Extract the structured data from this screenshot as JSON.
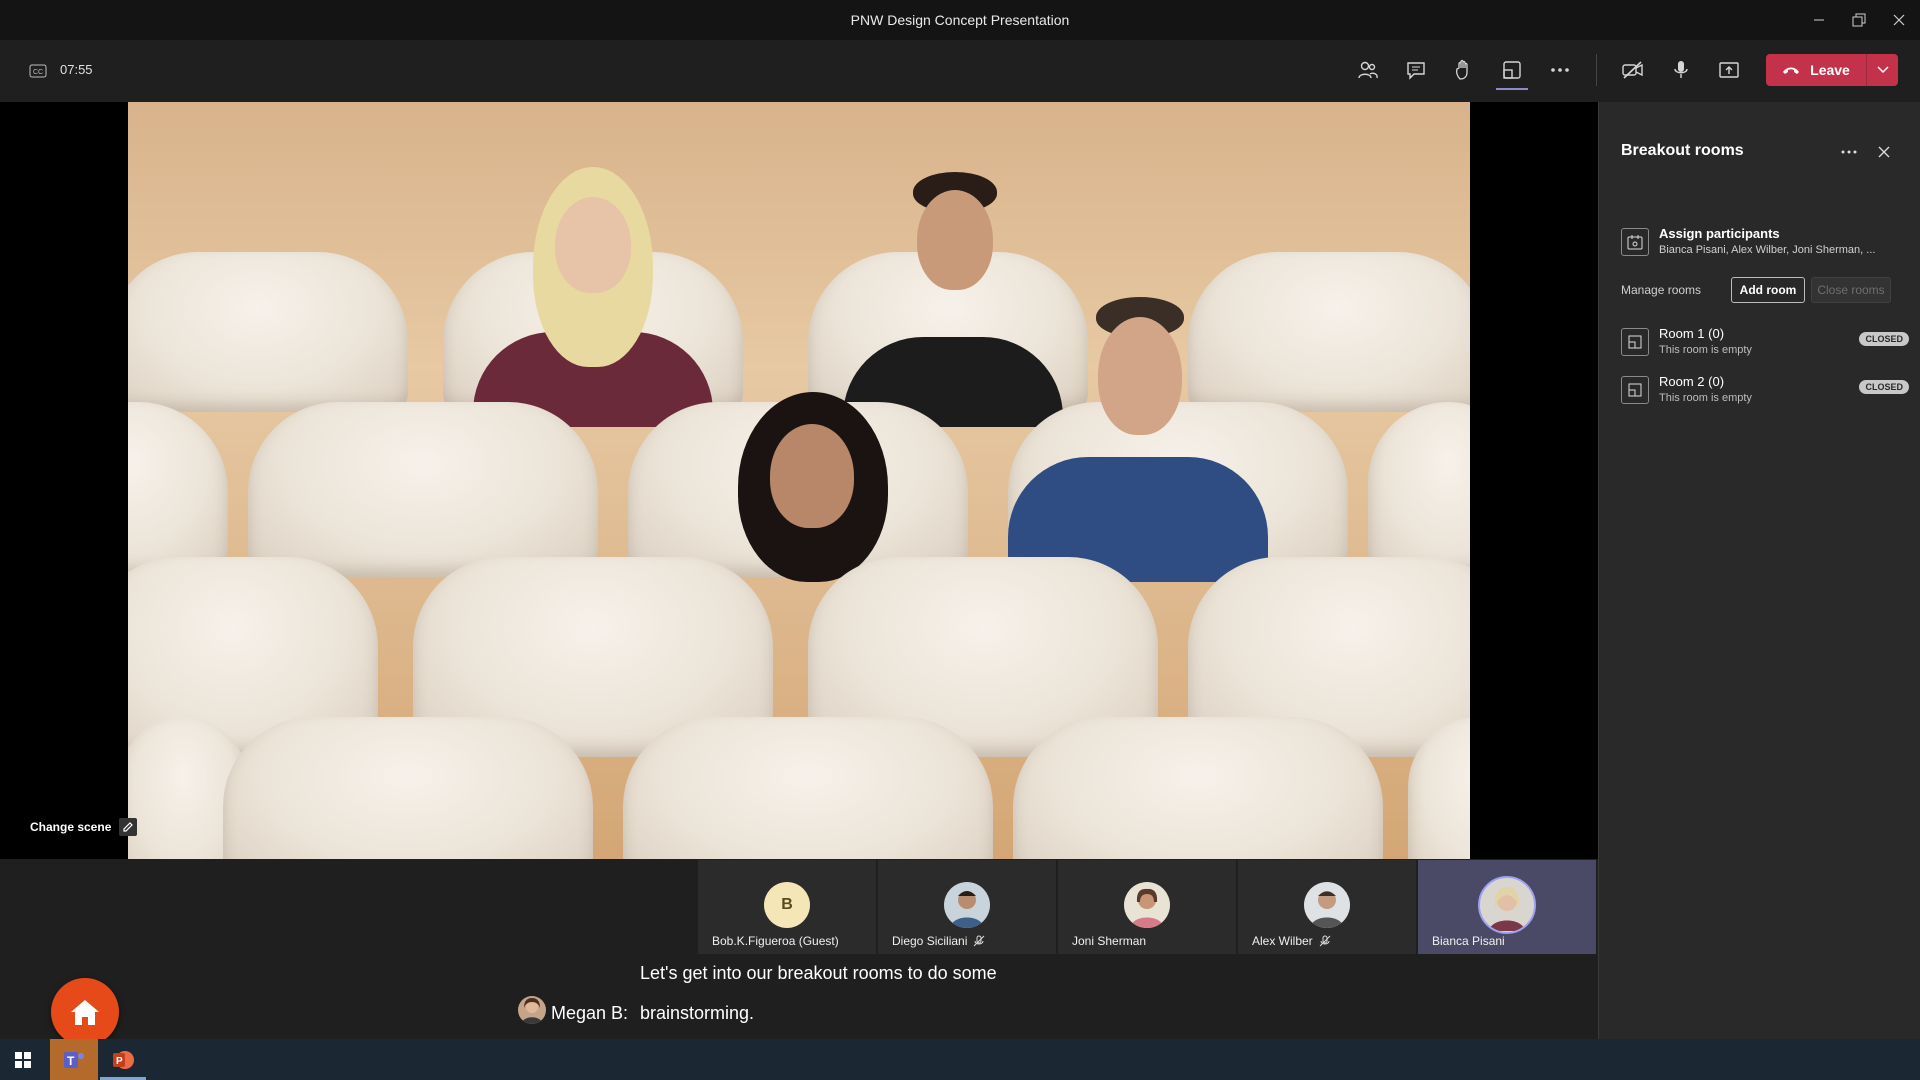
{
  "window": {
    "title": "PNW Design Concept Presentation"
  },
  "toolbar": {
    "timer": "07:55",
    "leave_label": "Leave",
    "icons": [
      "captions-icon",
      "participants-icon",
      "chat-icon",
      "raise-hand-icon",
      "breakout-rooms-icon",
      "more-icon",
      "camera-off-icon",
      "microphone-icon",
      "share-icon"
    ]
  },
  "stage": {
    "change_scene_label": "Change scene"
  },
  "participants": [
    {
      "name": "Bob.K.Figueroa (Guest)",
      "initial": "B",
      "muted": false
    },
    {
      "name": "Diego Siciliani",
      "muted": true
    },
    {
      "name": "Joni Sherman",
      "muted": false
    },
    {
      "name": "Alex Wilber",
      "muted": true
    },
    {
      "name": "Bianca Pisani",
      "muted": false
    }
  ],
  "captions": {
    "speaker": "Megan B:",
    "line1": "Let's get into our breakout rooms to do some",
    "line2": "brainstorming."
  },
  "breakout_panel": {
    "title": "Breakout rooms",
    "assign_title": "Assign participants",
    "assign_subtitle": "Bianca Pisani, Alex Wilber, Joni Sherman, ...",
    "manage_label": "Manage rooms",
    "add_room_label": "Add room",
    "close_rooms_label": "Close rooms",
    "rooms": [
      {
        "name": "Room 1 (0)",
        "status": "This room is empty",
        "badge": "CLOSED"
      },
      {
        "name": "Room 2 (0)",
        "status": "This room is empty",
        "badge": "CLOSED"
      }
    ]
  },
  "colors": {
    "leave": "#c4314b",
    "home_button": "#e64a19",
    "active_tile": "#4a4a66"
  }
}
